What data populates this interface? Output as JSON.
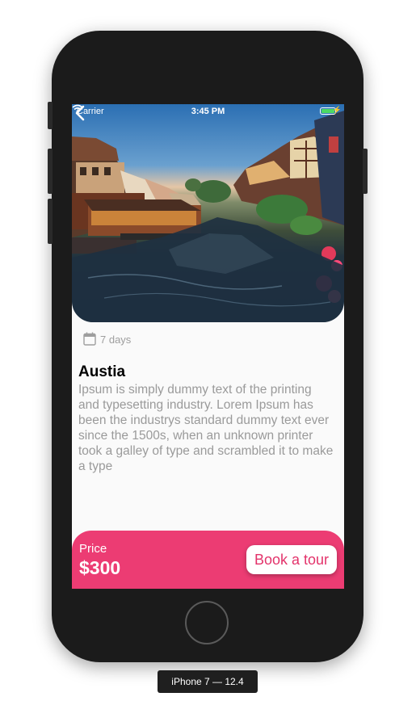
{
  "status_bar": {
    "carrier": "Carrier",
    "time": "3:45 PM"
  },
  "tour": {
    "duration": "7 days",
    "title": "Austia",
    "description": "Ipsum is simply dummy text of the printing and typesetting industry. Lorem Ipsum has been the industrys standard dummy text ever since the 1500s, when an unknown printer took a galley of type and scrambled it to make a type"
  },
  "footer": {
    "price_label": "Price",
    "price_value": "$300",
    "book_button": "Book a tour"
  },
  "device_label": "iPhone 7 — 12.4",
  "colors": {
    "accent": "#ec3c73",
    "battery": "#4cd964",
    "device": "#1b1b1b"
  },
  "icons": [
    "back-chevron-icon",
    "wifi-icon",
    "battery-icon",
    "charging-bolt-icon",
    "calendar-icon"
  ]
}
